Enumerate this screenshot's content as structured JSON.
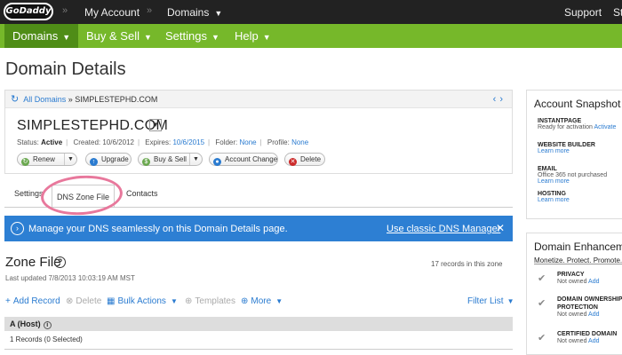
{
  "topbar": {
    "logo_text": "GoDaddy",
    "links": [
      "My Account",
      "Domains",
      "Support",
      "St"
    ]
  },
  "nav": {
    "items": [
      "Domains",
      "Buy & Sell",
      "Settings",
      "Help"
    ]
  },
  "page_title": "Domain Details",
  "breadcrumb": {
    "all_domains": "All Domains",
    "separator": "»",
    "current": "SIMPLESTEPHD.COM"
  },
  "domain": {
    "name": "SIMPLESTEPHD.COM",
    "status_label": "Status:",
    "status": "Active",
    "created_label": "Created:",
    "created": "10/6/2012",
    "expires_label": "Expires:",
    "expires": "10/6/2015",
    "folder_label": "Folder:",
    "folder": "None",
    "profile_label": "Profile:",
    "profile": "None"
  },
  "actions": [
    "Renew",
    "Upgrade",
    "Buy & Sell",
    "Account Change",
    "Delete"
  ],
  "tabs": [
    "Settings",
    "DNS Zone File",
    "Contacts"
  ],
  "banner": {
    "message": "Manage your DNS seamlessly on this Domain Details page.",
    "link": "Use classic DNS Manager",
    "close": "✕"
  },
  "zone": {
    "title": "Zone File",
    "records_count": "17 records in this zone",
    "updated": "Last updated 7/8/2013 10:03:19 AM MST"
  },
  "toolbar": {
    "add": "Add Record",
    "delete": "Delete",
    "bulk": "Bulk Actions",
    "templates": "Templates",
    "more": "More",
    "filter": "Filter List"
  },
  "section": {
    "title": "A (Host)",
    "selection": "1 Records (0 Selected)"
  },
  "snapshot": {
    "title": "Account Snapshot",
    "items": [
      {
        "heading": "INSTANTPAGE",
        "status": "Ready for activation",
        "link": "Activate"
      },
      {
        "heading": "WEBSITE BUILDER",
        "status": "",
        "link": "Learn more"
      },
      {
        "heading": "EMAIL",
        "status": "Office 365 not purchased",
        "link": "Learn more"
      },
      {
        "heading": "HOSTING",
        "status": "",
        "link": "Learn more"
      }
    ]
  },
  "enhancements": {
    "title": "Domain Enhancem",
    "subtitle": "Monetize. Protect. Promote.",
    "items": [
      {
        "heading": "PRIVACY",
        "status": "Not owned",
        "link": "Add"
      },
      {
        "heading": "DOMAIN OWNERSHIP PROTECTION",
        "status": "Not owned",
        "link": "Add"
      },
      {
        "heading": "CERTIFIED DOMAIN",
        "status": "Not owned",
        "link": "Add"
      }
    ]
  },
  "colors": {
    "nav_green": "#76b82a",
    "nav_active": "#4f8d17",
    "banner_blue": "#2d7fd3",
    "link_blue": "#2a7bd0",
    "annotation_pink": "#e8789c"
  },
  "icons": [
    "refresh-icon",
    "info-icon",
    "help-icon",
    "plus-icon",
    "checkmark-icon"
  ]
}
